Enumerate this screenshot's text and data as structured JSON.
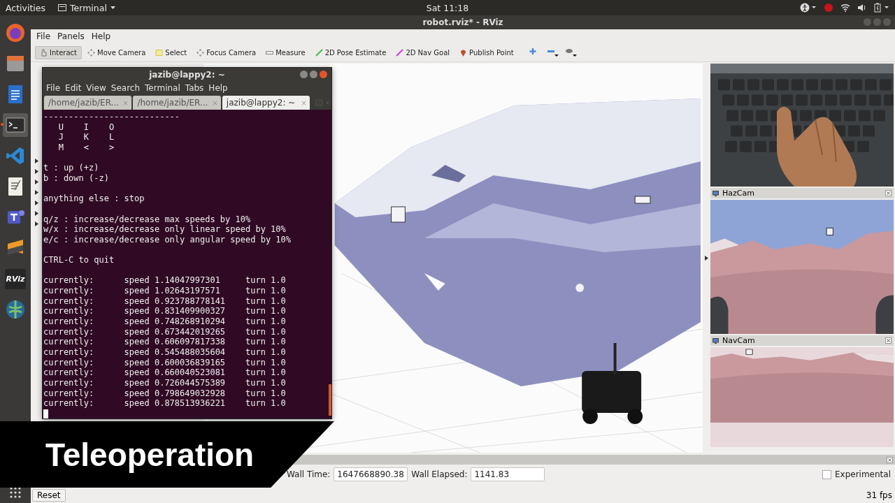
{
  "top_bar": {
    "activities": "Activities",
    "app_menu": "Terminal",
    "clock": "Sat 11:18"
  },
  "dock": [
    {
      "kind": "firefox",
      "selected": false
    },
    {
      "kind": "files",
      "selected": false
    },
    {
      "kind": "writer",
      "selected": false
    },
    {
      "kind": "terminal",
      "selected": true
    },
    {
      "kind": "vscode",
      "selected": false
    },
    {
      "kind": "editor",
      "selected": false
    },
    {
      "kind": "teams",
      "selected": false
    },
    {
      "kind": "sublime",
      "selected": false
    },
    {
      "kind": "rviz",
      "label": "RViz",
      "selected": false
    },
    {
      "kind": "globe",
      "selected": false
    }
  ],
  "rviz": {
    "title": "robot.rviz* - RViz",
    "menu": [
      "File",
      "Panels",
      "Help"
    ],
    "tools": [
      {
        "kind": "interact",
        "label": "Interact",
        "selected": true
      },
      {
        "kind": "move",
        "label": "Move Camera",
        "selected": false
      },
      {
        "kind": "select",
        "label": "Select",
        "selected": false
      },
      {
        "kind": "focus",
        "label": "Focus Camera",
        "selected": false
      },
      {
        "kind": "measure",
        "label": "Measure",
        "selected": false
      },
      {
        "kind": "pose",
        "label": "2D Pose Estimate",
        "selected": false
      },
      {
        "kind": "goal",
        "label": "2D Nav Goal",
        "selected": false
      },
      {
        "kind": "point",
        "label": "Publish Point",
        "selected": false
      }
    ],
    "view_buttons": [
      {
        "kind": "plus"
      },
      {
        "kind": "minus"
      },
      {
        "kind": "eye"
      }
    ],
    "camera_panels": [
      {
        "title": "HazCam"
      },
      {
        "title": "NavCam"
      }
    ],
    "time": {
      "wall_time_label": "Wall Time:",
      "wall_time": "1647668890.38",
      "wall_elapsed_label": "Wall Elapsed:",
      "wall_elapsed": "1141.83",
      "experimental_label": "Experimental",
      "experimental_checked": false,
      "reset": "Reset",
      "fps": "31 fps"
    }
  },
  "terminal": {
    "title": "jazib@lappy2: ~",
    "menu": [
      "File",
      "Edit",
      "View",
      "Search",
      "Terminal",
      "Tabs",
      "Help"
    ],
    "tabs": [
      {
        "label": "/home/jazib/ER...",
        "selected": false
      },
      {
        "label": "/home/jazib/ER...",
        "selected": false
      },
      {
        "label": "jazib@lappy2: ~",
        "selected": true
      }
    ],
    "blocks": [
      [
        "---------------------------",
        "   U    I    O",
        "   J    K    L",
        "   M    <    >"
      ],
      [
        "t : up (+z)",
        "b : down (-z)"
      ],
      [
        "anything else : stop"
      ],
      [
        "q/z : increase/decrease max speeds by 10%",
        "w/x : increase/decrease only linear speed by 10%",
        "e/c : increase/decrease only angular speed by 10%"
      ],
      [
        "CTRL-C to quit"
      ],
      [
        "currently:      speed 1.14047997301     turn 1.0",
        "currently:      speed 1.02643197571     turn 1.0",
        "currently:      speed 0.923788778141    turn 1.0",
        "currently:      speed 0.831409900327    turn 1.0",
        "currently:      speed 0.748268910294    turn 1.0",
        "currently:      speed 0.673442019265    turn 1.0",
        "currently:      speed 0.606097817338    turn 1.0",
        "currently:      speed 0.545488035604    turn 1.0",
        "currently:      speed 0.600036839165    turn 1.0",
        "currently:      speed 0.660040523081    turn 1.0",
        "currently:      speed 0.726044575389    turn 1.0",
        "currently:      speed 0.798649032928    turn 1.0",
        "currently:      speed 0.878513936221    turn 1.0"
      ]
    ]
  },
  "caption": "Teleoperation"
}
